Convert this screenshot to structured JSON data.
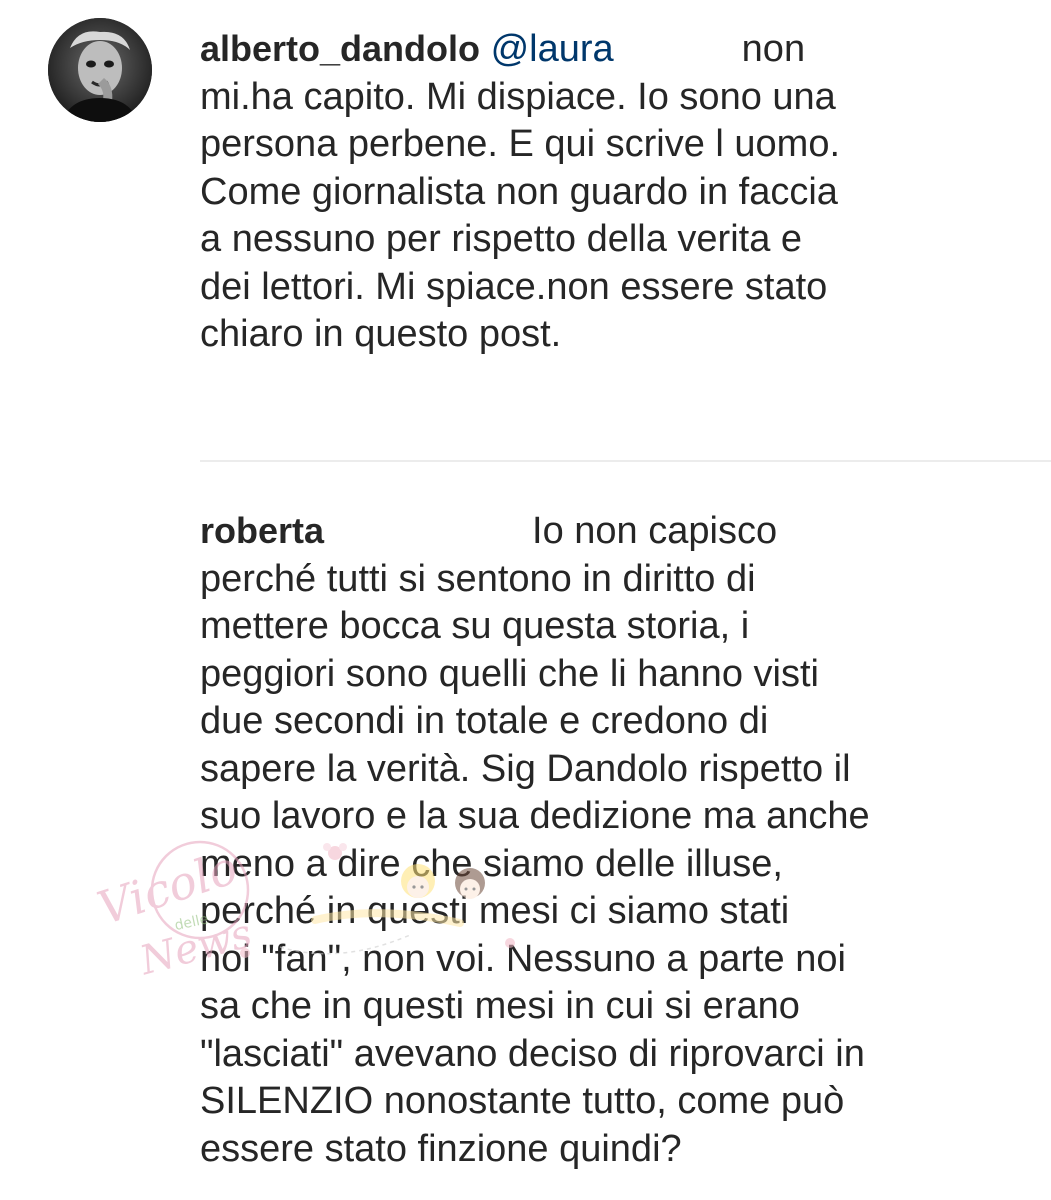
{
  "comments": [
    {
      "username": "alberto_dandolo",
      "mention": "@laura",
      "lines": [
        "non",
        "mi.ha capito. Mi dispiace. Io sono una",
        "persona perbene. E qui scrive l uomo.",
        "Come giornalista non guardo in faccia",
        "a nessuno per rispetto della verita e",
        "dei lettori. Mi spiace.non essere stato",
        "chiaro in questo post."
      ]
    },
    {
      "username": "roberta",
      "lines": [
        "Io non capisco",
        "perché tutti si sentono in diritto di",
        "mettere bocca su questa storia, i",
        "peggiori sono quelli che li hanno visti",
        "due secondi in totale e credono di",
        "sapere la verità. Sig Dandolo rispetto il",
        "suo lavoro e la sua dedizione ma anche",
        "meno a dire che siamo delle illuse,",
        "perché in questi mesi ci siamo stati",
        "noi \"fan\", non voi. Nessuno a parte noi",
        "sa che in questi mesi in cui si erano",
        "\"lasciati\" avevano deciso di riprovarci in",
        "SILENZIO nonostante tutto, come può",
        "essere stato finzione quindi?"
      ]
    }
  ],
  "watermark": {
    "line1": "Vicolo",
    "line2": "delle",
    "line3": "News"
  },
  "colors": {
    "text": "#262626",
    "mention": "#00376b",
    "divider": "#ececec",
    "watermark": "#e7a3bd"
  }
}
